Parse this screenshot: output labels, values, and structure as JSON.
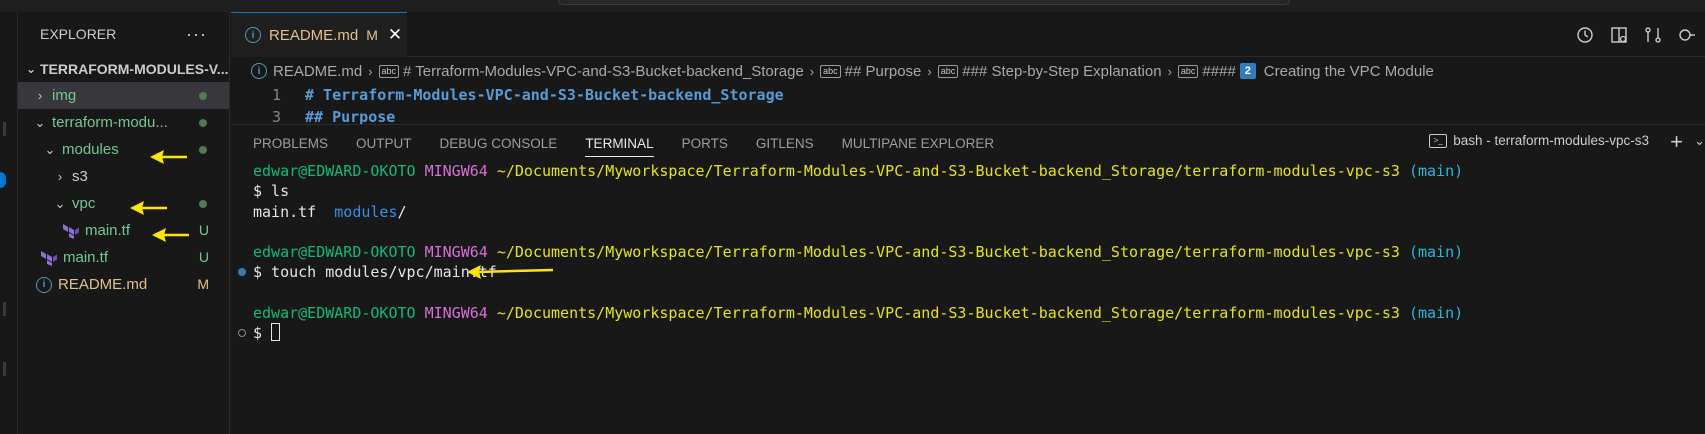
{
  "sidebar": {
    "title": "EXPLORER",
    "more": "···",
    "root": "TERRAFORM-MODULES-V...",
    "items": [
      {
        "label": "img",
        "chevron": "›"
      },
      {
        "label": "terraform-modu...",
        "chevron": "⌄"
      },
      {
        "label": "modules",
        "chevron": "⌄"
      },
      {
        "label": "s3",
        "chevron": "›"
      },
      {
        "label": "vpc",
        "chevron": "⌄"
      },
      {
        "label": "main.tf",
        "status": "U"
      },
      {
        "label": "main.tf",
        "status": "U"
      },
      {
        "label": "README.md",
        "status": "M"
      }
    ]
  },
  "tab": {
    "label": "README.md",
    "status": "M",
    "close": "✕"
  },
  "breadcrumb": {
    "file": "README.md",
    "h1": "# Terraform-Modules-VPC-and-S3-Bucket-backend_Storage",
    "h2": "## Purpose",
    "h3": "### Step-by-Step Explanation",
    "h4_prefix": "####",
    "h4_num": "2",
    "h4_title": "Creating the VPC Module",
    "abc": "abc"
  },
  "code": {
    "lines": [
      {
        "num": "1",
        "text": "# Terraform-Modules-VPC-and-S3-Bucket-backend_Storage"
      },
      {
        "num": "3",
        "text": "## Purpose"
      }
    ]
  },
  "panel": {
    "tabs": [
      "PROBLEMS",
      "OUTPUT",
      "DEBUG CONSOLE",
      "TERMINAL",
      "PORTS",
      "GITLENS",
      "MULTIPANE EXPLORER"
    ],
    "terminal_name": "bash - terraform-modules-vpc-s3",
    "plus": "+"
  },
  "terminal": {
    "user": "edwar@EDWARD-OKOTO",
    "shell": "MINGW64",
    "path": "~/Documents/Myworkspace/Terraform-Modules-VPC-and-S3-Bucket-backend_Storage/terraform-modules-vpc-s3",
    "branch": "(main)",
    "cmd1": "$ ls",
    "out_file": "main.tf",
    "out_dir": "modules",
    "out_slash": "/",
    "cmd2": "$ touch modules/vpc/main.tf",
    "prompt": "$ "
  },
  "colors": {
    "accent": "#0078d4",
    "untracked": "#73c991",
    "modified": "#e2c08d",
    "arrow": "#ffe600"
  }
}
